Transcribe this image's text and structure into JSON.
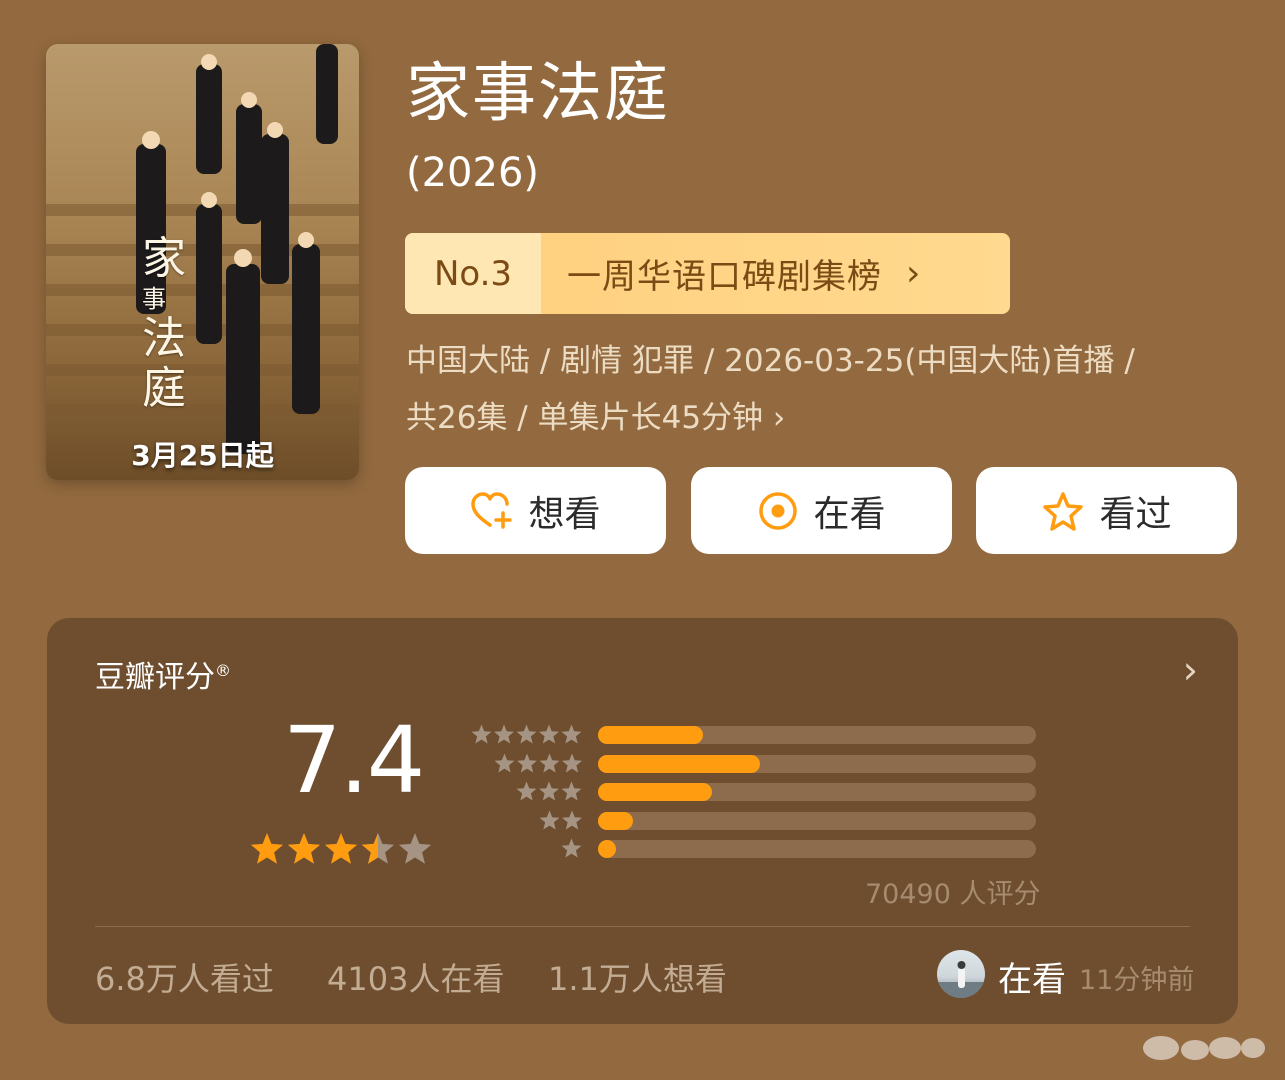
{
  "poster": {
    "title_chars": [
      "家",
      "事",
      "法",
      "庭"
    ],
    "release_text": "3月25日起"
  },
  "show": {
    "title": "家事法庭",
    "year": "(2026)"
  },
  "ranking": {
    "number": "No.3",
    "list_name": "一周华语口碑剧集榜",
    "chevron": "›"
  },
  "meta": {
    "line1": "中国大陆 / 剧情 犯罪 / 2026-03-25(中国大陆)首播 /",
    "line2": "共26集 / 单集片长45分钟 ›"
  },
  "actions": {
    "want": "想看",
    "watching": "在看",
    "watched": "看过"
  },
  "rating": {
    "title": "豆瓣评分",
    "trademark": "®",
    "chevron": "›",
    "score": "7.4",
    "stars_value": 3.5,
    "stars_max": 5,
    "distribution": [
      {
        "stars": 5,
        "fraction": 0.24
      },
      {
        "stars": 4,
        "fraction": 0.37
      },
      {
        "stars": 3,
        "fraction": 0.26
      },
      {
        "stars": 2,
        "fraction": 0.08
      },
      {
        "stars": 1,
        "fraction": 0.04
      }
    ],
    "count_text": "70490 人评分"
  },
  "stats": {
    "watched": "6.8万人看过",
    "watching": "4103人在看",
    "want": "1.1万人想看"
  },
  "friend": {
    "status": "在看",
    "time": "11分钟前"
  },
  "colors": {
    "background": "#936a3f",
    "card": "#6e4e2f",
    "accent_orange": "#ff9c10",
    "rank_text": "#7a4b14"
  }
}
